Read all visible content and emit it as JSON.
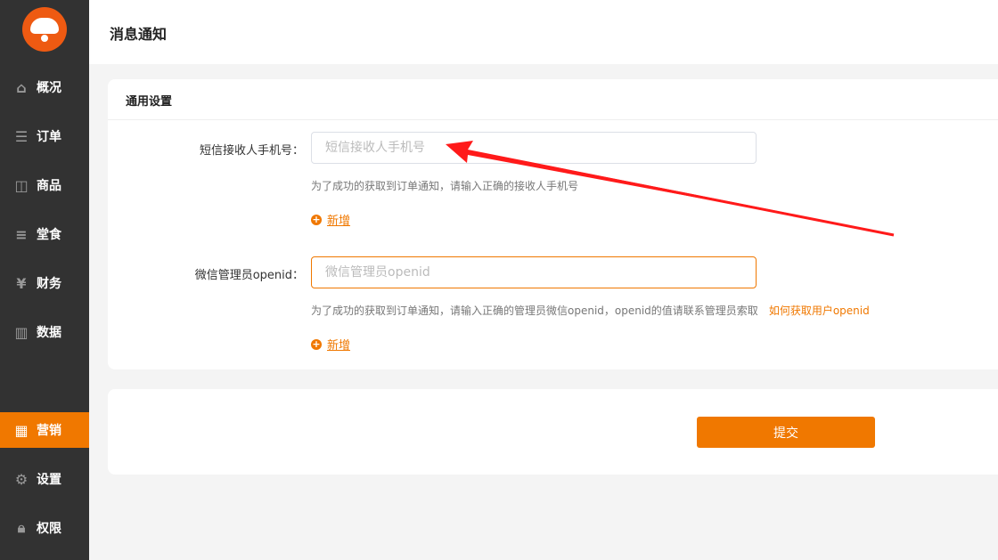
{
  "sidebar": {
    "items": [
      {
        "label": "概况",
        "icon": "home-icon"
      },
      {
        "label": "订单",
        "icon": "order-icon"
      },
      {
        "label": "商品",
        "icon": "bag-icon"
      },
      {
        "label": "堂食",
        "icon": "menu-icon"
      },
      {
        "label": "财务",
        "icon": "wallet-icon"
      },
      {
        "label": "数据",
        "icon": "chart-icon"
      },
      {
        "label": "营销",
        "icon": "grid-icon",
        "active": true
      },
      {
        "label": "设置",
        "icon": "gear-icon"
      },
      {
        "label": "权限",
        "icon": "lock-icon"
      }
    ]
  },
  "header": {
    "title": "消息通知"
  },
  "settings": {
    "section_title": "通用设置",
    "phone": {
      "label": "短信接收人手机号：",
      "placeholder": "短信接收人手机号",
      "value": "",
      "hint": "为了成功的获取到订单通知，请输入正确的接收人手机号",
      "add_label": "新增"
    },
    "openid": {
      "label": "微信管理员openid：",
      "placeholder": "微信管理员openid",
      "value": "",
      "hint": "为了成功的获取到订单通知，请输入正确的管理员微信openid，openid的值请联系管理员索取",
      "help_link": "如何获取用户openid",
      "add_label": "新增"
    }
  },
  "submit_label": "提交",
  "colors": {
    "accent": "#f07800",
    "sidebar": "#323232",
    "annotation": "#ff1a1a"
  }
}
